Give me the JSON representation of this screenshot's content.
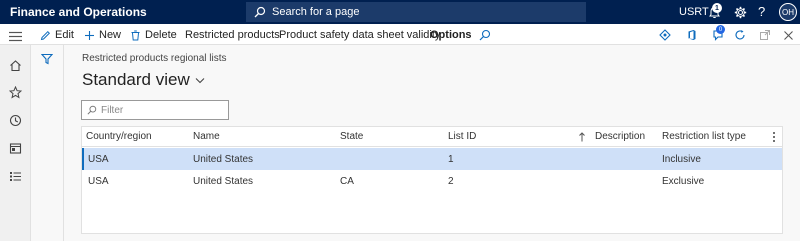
{
  "topbar": {
    "app_title": "Finance and Operations",
    "search_placeholder": "Search for a page",
    "company": "USRT",
    "notification_count": "1",
    "help_glyph": "?",
    "user_initials": "OH",
    "icons": [
      "search-icon",
      "bell-icon",
      "gear-icon",
      "help-icon"
    ]
  },
  "actions": {
    "edit": "Edit",
    "new": "New",
    "delete": "Delete",
    "restricted_products": "Restricted products",
    "safety_data_sheet": "Product safety data sheet validity",
    "options": "Options",
    "attachment_count": "0",
    "right_icons": [
      "diamond-icon",
      "office-icon",
      "attachment-icon",
      "refresh-icon",
      "open-new-window-icon",
      "close-icon"
    ]
  },
  "nav_icons": [
    "home-icon",
    "star-icon",
    "clock-icon",
    "workspace-icon",
    "list-icon"
  ],
  "page": {
    "caption": "Restricted products regional lists",
    "view_name": "Standard view",
    "filter_placeholder": "Filter"
  },
  "grid": {
    "columns": [
      "Country/region",
      "Name",
      "State",
      "List ID",
      "Description",
      "Restriction list type"
    ],
    "rows": [
      {
        "country": "USA",
        "name": "United States",
        "state": "",
        "list_id": "1",
        "description": "",
        "type": "Inclusive",
        "selected": true
      },
      {
        "country": "USA",
        "name": "United States",
        "state": "CA",
        "list_id": "2",
        "description": "",
        "type": "Exclusive",
        "selected": false
      }
    ]
  },
  "colors": {
    "topbar": "#002050",
    "accent": "#0f6cbd",
    "selected_row": "#cfe0f8"
  }
}
